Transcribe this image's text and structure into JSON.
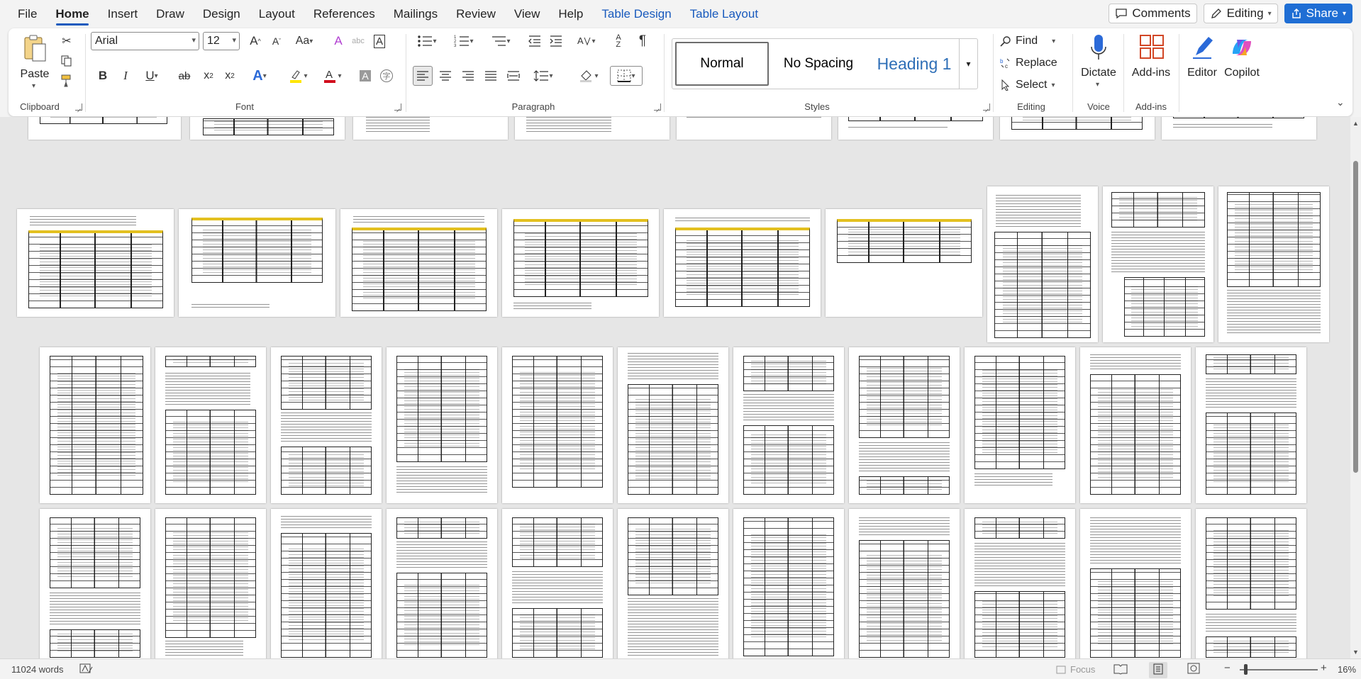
{
  "menu": {
    "tabs": [
      {
        "label": "File"
      },
      {
        "label": "Home"
      },
      {
        "label": "Insert"
      },
      {
        "label": "Draw"
      },
      {
        "label": "Design"
      },
      {
        "label": "Layout"
      },
      {
        "label": "References"
      },
      {
        "label": "Mailings"
      },
      {
        "label": "Review"
      },
      {
        "label": "View"
      },
      {
        "label": "Help"
      },
      {
        "label": "Table Design"
      },
      {
        "label": "Table Layout"
      }
    ],
    "active_tab": "Home",
    "comments_label": "Comments",
    "editing_label": "Editing",
    "share_label": "Share",
    "accent_color": "#185abd"
  },
  "ribbon": {
    "clipboard": {
      "label": "Clipboard",
      "paste_label": "Paste"
    },
    "font": {
      "label": "Font",
      "font_name": "Arial",
      "font_size": "12"
    },
    "paragraph": {
      "label": "Paragraph"
    },
    "styles": {
      "label": "Styles",
      "items": [
        "Normal",
        "No Spacing",
        "Heading 1"
      ],
      "selected": "Normal"
    },
    "editing": {
      "label": "Editing",
      "find": "Find",
      "replace": "Replace",
      "select": "Select"
    },
    "voice": {
      "label": "Voice",
      "dictate": "Dictate"
    },
    "addins": {
      "label": "Add-ins",
      "addins_button": "Add-ins"
    },
    "editor": {
      "label": "Editor"
    },
    "copilot": {
      "label": "Copilot"
    }
  },
  "status": {
    "word_count": "11024 words",
    "focus": "Focus",
    "zoom": "16%"
  }
}
